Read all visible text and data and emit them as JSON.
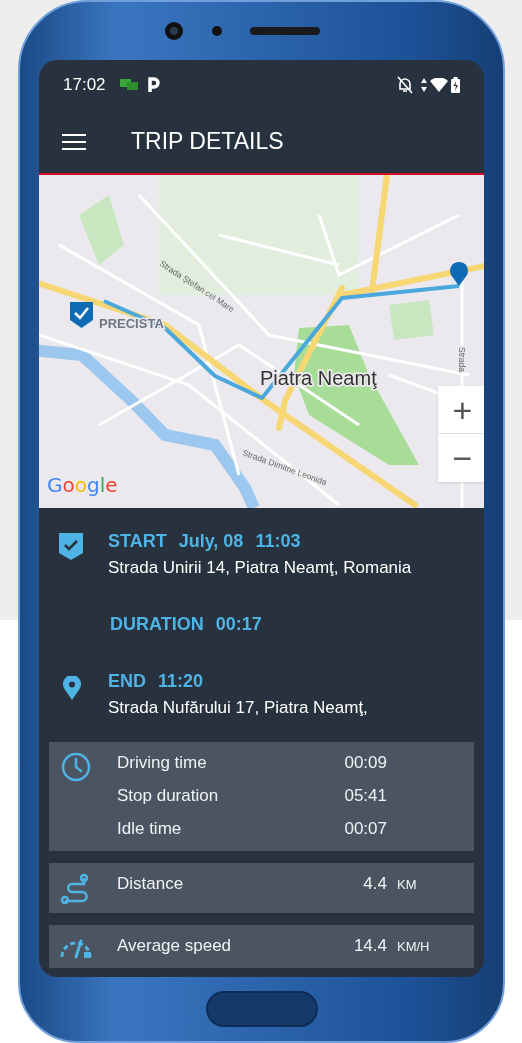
{
  "status_bar": {
    "time": "17:02"
  },
  "app_bar": {
    "title": "TRIP DETAILS"
  },
  "map": {
    "street_labels": [
      "Strada Ştefan cel Mare",
      "Strada Dimitrie Leonida",
      "Strada"
    ],
    "place_label": "PRECISTA",
    "city_label": "Piatra Neamţ",
    "logo": "Google",
    "zoom_in": "+",
    "zoom_out": "−"
  },
  "trip": {
    "start": {
      "label": "START",
      "date": "July, 08",
      "time": "11:03",
      "address": "Strada Unirii 14, Piatra Neamţ, Romania"
    },
    "duration": {
      "label": "DURATION",
      "value": "00:17"
    },
    "end": {
      "label": "END",
      "time": "11:20",
      "address": "Strada Nufărului 17, Piatra Neamţ,"
    }
  },
  "stats": [
    {
      "kind": "clock",
      "rows": [
        {
          "label": "Driving time",
          "value": "00:09"
        },
        {
          "label": "Stop duration",
          "value": "05:41"
        },
        {
          "label": "Idle time",
          "value": "00:07"
        }
      ]
    },
    {
      "kind": "route",
      "rows": [
        {
          "label": "Distance",
          "value": "4.4",
          "unit": "KM"
        }
      ]
    },
    {
      "kind": "speed",
      "rows": [
        {
          "label": "Average speed",
          "value": "14.4",
          "unit": "KM/H"
        }
      ]
    }
  ]
}
